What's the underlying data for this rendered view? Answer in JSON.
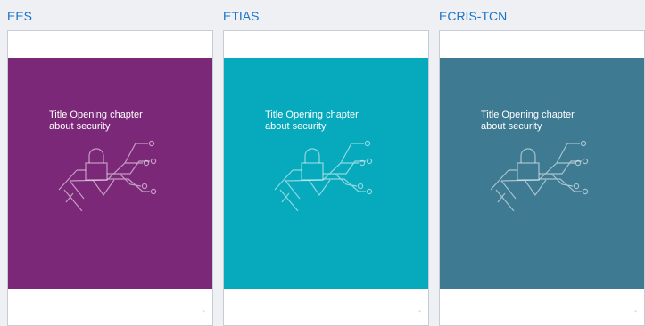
{
  "columns": [
    {
      "label": "EES",
      "cover_title_line1": "Title Opening chapter",
      "cover_title_line2": "about security",
      "cover_color": "#7b2878",
      "icon": "padlock-circuit-icon"
    },
    {
      "label": "ETIAS",
      "cover_title_line1": "Title Opening chapter",
      "cover_title_line2": "about security",
      "cover_color": "#07a9bc",
      "icon": "padlock-circuit-icon"
    },
    {
      "label": "ECRIS-TCN",
      "cover_title_line1": "Title Opening chapter",
      "cover_title_line2": "about security",
      "cover_color": "#3e7a91",
      "icon": "padlock-circuit-icon"
    }
  ],
  "page_marker": "+"
}
